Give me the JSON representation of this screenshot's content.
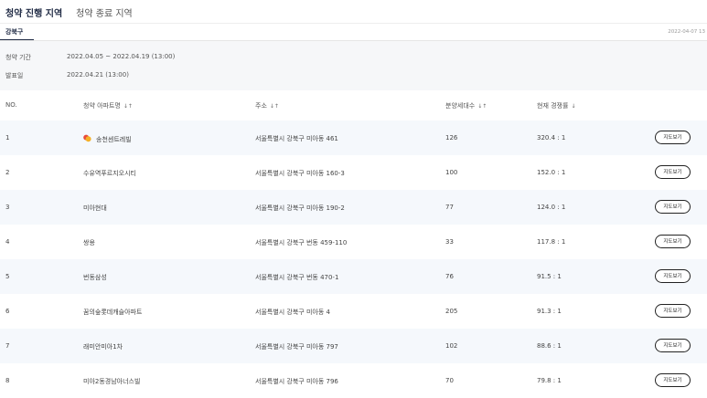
{
  "top_tabs": {
    "active": "청약 진행 지역",
    "inactive": "청약 종료 지역"
  },
  "district": {
    "tab": "강북구",
    "date": "2022-04-07 13"
  },
  "info": {
    "period_label": "청약 기간",
    "period_value": "2022.04.05 ~ 2022.04.19 (13:00)",
    "announce_label": "발표일",
    "announce_value": "2022.04.21 (13:00)"
  },
  "table": {
    "headers": {
      "no": "NO.",
      "name": "청약 아파트명",
      "address": "주소",
      "units": "분양세대수",
      "rate": "현재 경쟁률"
    },
    "sort_icons": {
      "both": "↓↑",
      "down": "↓"
    },
    "map_button_label": "지도보기",
    "rows": [
      {
        "no": "1",
        "name": "송천센트레빌",
        "address": "서울특별시 강북구 미아동 461",
        "units": "126",
        "rate": "320.4 : 1"
      },
      {
        "no": "2",
        "name": "수유역푸르지오시티",
        "address": "서울특별시 강북구 미아동 160-3",
        "units": "100",
        "rate": "152.0 : 1"
      },
      {
        "no": "3",
        "name": "미아현대",
        "address": "서울특별시 강북구 미아동 190-2",
        "units": "77",
        "rate": "124.0 : 1"
      },
      {
        "no": "4",
        "name": "쌍용",
        "address": "서울특별시 강북구 번동 459-110",
        "units": "33",
        "rate": "117.8 : 1"
      },
      {
        "no": "5",
        "name": "번동삼성",
        "address": "서울특별시 강북구 번동 470-1",
        "units": "76",
        "rate": "91.5 : 1"
      },
      {
        "no": "6",
        "name": "꿈의숲롯데캐슬아파트",
        "address": "서울특별시 강북구 미아동 4",
        "units": "205",
        "rate": "91.3 : 1"
      },
      {
        "no": "7",
        "name": "래미안미아1차",
        "address": "서울특별시 강북구 미아동 797",
        "units": "102",
        "rate": "88.6 : 1"
      },
      {
        "no": "8",
        "name": "미아2동경남아너스빌",
        "address": "서울특별시 강북구 미아동 796",
        "units": "70",
        "rate": "79.8 : 1"
      }
    ]
  },
  "colors": {
    "accent": "#1f2a44",
    "row_alt": "#f5f8fc",
    "info_bg": "#f6f7f9",
    "pin_red": "#e84b3c",
    "pin_yellow": "#f5b025"
  },
  "icons": {
    "first_row_marker": "location-pin-icon"
  }
}
